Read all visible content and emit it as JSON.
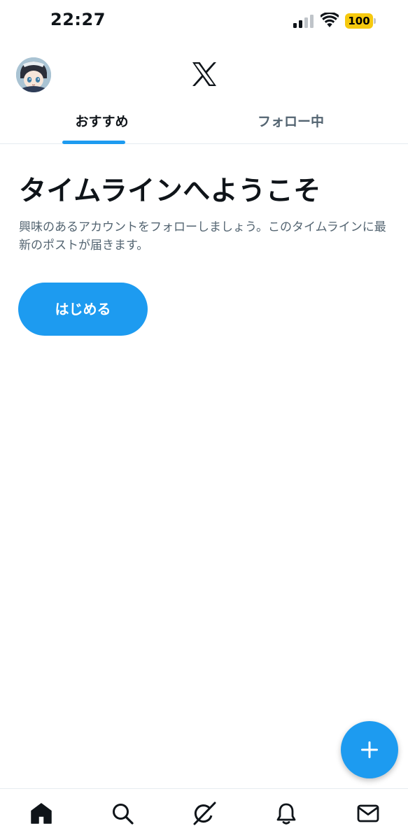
{
  "status_bar": {
    "time": "22:27",
    "battery": "100",
    "battery_color": "#f6c90e"
  },
  "header": {
    "avatar_icon": "avatar-icon",
    "logo_icon": "x-logo-icon"
  },
  "tabs": [
    {
      "label": "おすすめ",
      "active": true
    },
    {
      "label": "フォロー中",
      "active": false
    }
  ],
  "welcome": {
    "title": "タイムラインへようこそ",
    "description": "興味のあるアカウントをフォローしましょう。このタイムラインに最新のポストが届きます。",
    "button_label": "はじめる"
  },
  "fab": {
    "icon": "plus-icon"
  },
  "bottom_nav": [
    {
      "name": "home",
      "icon": "home-icon",
      "active": true
    },
    {
      "name": "search",
      "icon": "search-icon",
      "active": false
    },
    {
      "name": "grok",
      "icon": "grok-icon",
      "active": false
    },
    {
      "name": "notifications",
      "icon": "bell-icon",
      "active": false
    },
    {
      "name": "messages",
      "icon": "mail-icon",
      "active": false
    }
  ],
  "colors": {
    "accent": "#1d9bf0",
    "text_primary": "#0f1419",
    "text_secondary": "#536471",
    "divider": "#e6ecf0"
  }
}
